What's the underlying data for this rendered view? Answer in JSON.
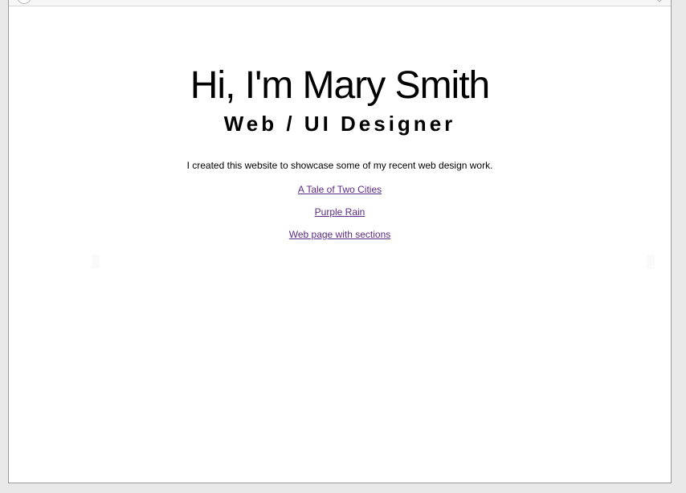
{
  "page": {
    "title": "Hi, I'm Mary Smith",
    "subtitle": "Web / UI Designer",
    "intro": "I created this website to showcase some of my recent web design work."
  },
  "links": [
    {
      "label": "A Tale of Two Cities"
    },
    {
      "label": "Purple Rain"
    },
    {
      "label": "Web page with sections"
    }
  ],
  "colors": {
    "background": "#ffffff",
    "text": "#000000",
    "link": "#5b2a86",
    "frame": "#e9e9e9"
  }
}
